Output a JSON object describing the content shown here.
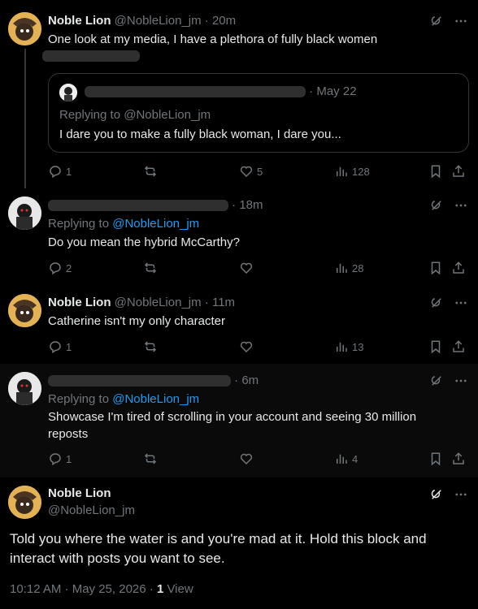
{
  "colors": {
    "background": "#000000",
    "text": "#e7e9ea",
    "muted": "#71767b",
    "link": "#1d9bf0",
    "border": "#333639"
  },
  "posts": [
    {
      "name": "Noble Lion",
      "handle": "@NobleLion_jm",
      "time": "20m",
      "text": "One look at my media, I have a plethora of fully black women",
      "quote": {
        "time": "May 22",
        "replying": "Replying to @NobleLion_jm",
        "text": "I dare you to make a fully black woman, I dare you..."
      },
      "replies": "1",
      "reposts": "",
      "likes": "5",
      "views": "128"
    },
    {
      "time": "18m",
      "replying_prefix": "Replying to ",
      "replying_handle": "@NobleLion_jm",
      "text": "Do you mean the hybrid McCarthy?",
      "replies": "2",
      "reposts": "",
      "likes": "",
      "views": "28"
    },
    {
      "name": "Noble Lion",
      "handle": "@NobleLion_jm",
      "time": "11m",
      "text": "Catherine isn't my only character",
      "replies": "1",
      "reposts": "",
      "likes": "",
      "views": "13"
    },
    {
      "time": "6m",
      "replying_prefix": "Replying to ",
      "replying_handle": "@NobleLion_jm",
      "text": "Showcase I'm tired of scrolling in your account and seeing 30 million reposts",
      "replies": "1",
      "reposts": "",
      "likes": "",
      "views": "4"
    }
  ],
  "main_post": {
    "name": "Noble Lion",
    "handle": "@NobleLion_jm",
    "text": "Told you where the water is and you're mad at it. Hold this block and interact with posts you want to see.",
    "timestamp": "10:12 AM · May 25, 2026 · ",
    "views_count": "1",
    "views_label": " View"
  }
}
